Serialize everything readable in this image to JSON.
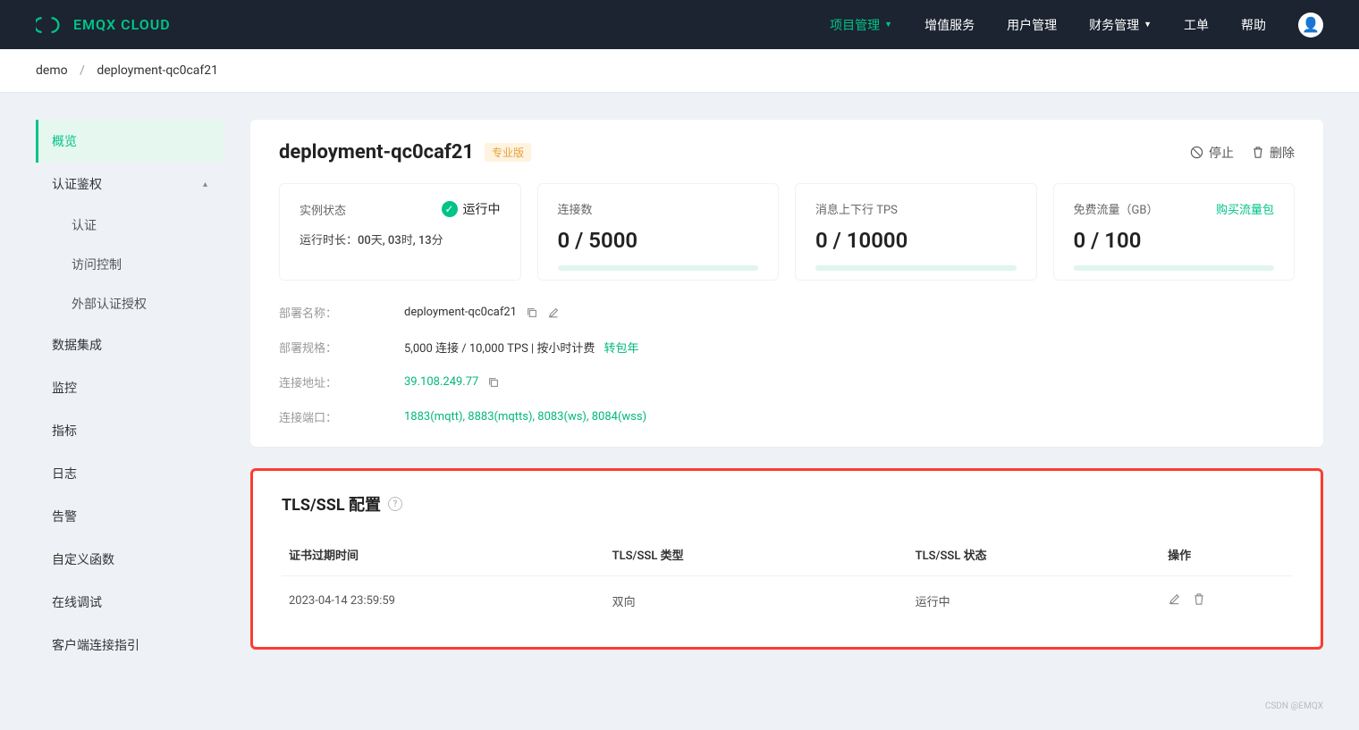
{
  "header": {
    "brand": "EMQX CLOUD",
    "nav": [
      {
        "label": "项目管理",
        "active": true,
        "dropdown": true
      },
      {
        "label": "增值服务"
      },
      {
        "label": "用户管理"
      },
      {
        "label": "财务管理",
        "dropdown": true
      },
      {
        "label": "工单"
      },
      {
        "label": "帮助"
      }
    ]
  },
  "breadcrumb": {
    "root": "demo",
    "current": "deployment-qc0caf21"
  },
  "sidebar": {
    "items": [
      {
        "label": "概览",
        "active": true
      },
      {
        "label": "认证鉴权",
        "expandable": true,
        "children": [
          "认证",
          "访问控制",
          "外部认证授权"
        ]
      },
      {
        "label": "数据集成"
      },
      {
        "label": "监控"
      },
      {
        "label": "指标"
      },
      {
        "label": "日志"
      },
      {
        "label": "告警"
      },
      {
        "label": "自定义函数"
      },
      {
        "label": "在线调试"
      },
      {
        "label": "客户端连接指引"
      }
    ]
  },
  "deployment": {
    "name": "deployment-qc0caf21",
    "badge": "专业版",
    "actions": {
      "stop": "停止",
      "delete": "删除"
    },
    "stats": [
      {
        "label": "实例状态",
        "status": "运行中",
        "runtime_label": "运行时长：",
        "runtime_val": "00天, 03时, 13分",
        "type": "status"
      },
      {
        "label": "连接数",
        "value": "0 / 5000"
      },
      {
        "label": "消息上下行 TPS",
        "value": "0 / 10000"
      },
      {
        "label": "免费流量（GB）",
        "value": "0 / 100",
        "link": "购买流量包"
      }
    ],
    "info": [
      {
        "label": "部署名称：",
        "value": "deployment-qc0caf21",
        "copy": true,
        "edit": true
      },
      {
        "label": "部署规格：",
        "value": "5,000 连接 / 10,000 TPS | 按小时计费",
        "link": "转包年"
      },
      {
        "label": "连接地址：",
        "value": "39.108.249.77",
        "green": true,
        "copy": true
      },
      {
        "label": "连接端口：",
        "value": "1883(mqtt), 8883(mqtts), 8083(ws), 8084(wss)",
        "green": true
      }
    ]
  },
  "tls": {
    "title": "TLS/SSL 配置",
    "columns": [
      "证书过期时间",
      "TLS/SSL 类型",
      "TLS/SSL 状态",
      "操作"
    ],
    "rows": [
      {
        "expire": "2023-04-14 23:59:59",
        "type": "双向",
        "status": "运行中"
      }
    ]
  },
  "watermark": "CSDN @EMQX"
}
